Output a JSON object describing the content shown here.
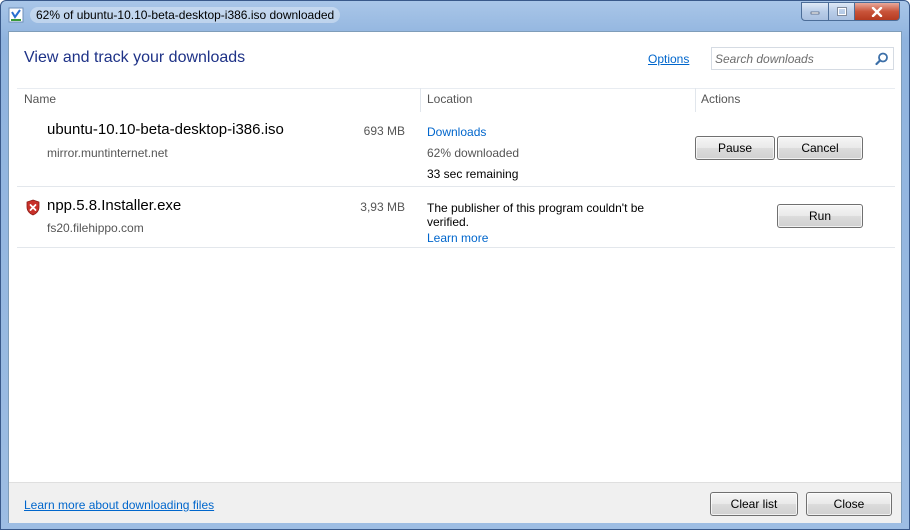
{
  "window": {
    "title": "62% of ubuntu-10.10-beta-desktop-i386.iso downloaded"
  },
  "header": {
    "heading": "View and track your downloads",
    "options_label": "Options",
    "search_placeholder": "Search downloads"
  },
  "columns": {
    "name": "Name",
    "location": "Location",
    "actions": "Actions"
  },
  "downloads": [
    {
      "name": "ubuntu-10.10-beta-desktop-i386.iso",
      "size": "693 MB",
      "source": "mirror.muntinternet.net",
      "location_link": "Downloads",
      "progress_text": "62% downloaded",
      "progress": 0.62,
      "remaining": "33 sec remaining",
      "pause_label": "Pause",
      "cancel_label": "Cancel"
    },
    {
      "name": "npp.5.8.Installer.exe",
      "size": "3,93 MB",
      "source": "fs20.filehippo.com",
      "warning": "The publisher of this program couldn't be verified.",
      "learn_more": "Learn more",
      "run_label": "Run"
    }
  ],
  "footer": {
    "learn_link": "Learn more about downloading files",
    "clear_label": "Clear list",
    "close_label": "Close"
  },
  "colors": {
    "heading": "#1e3287",
    "link": "#0066cc",
    "shield": "#c8302a"
  }
}
